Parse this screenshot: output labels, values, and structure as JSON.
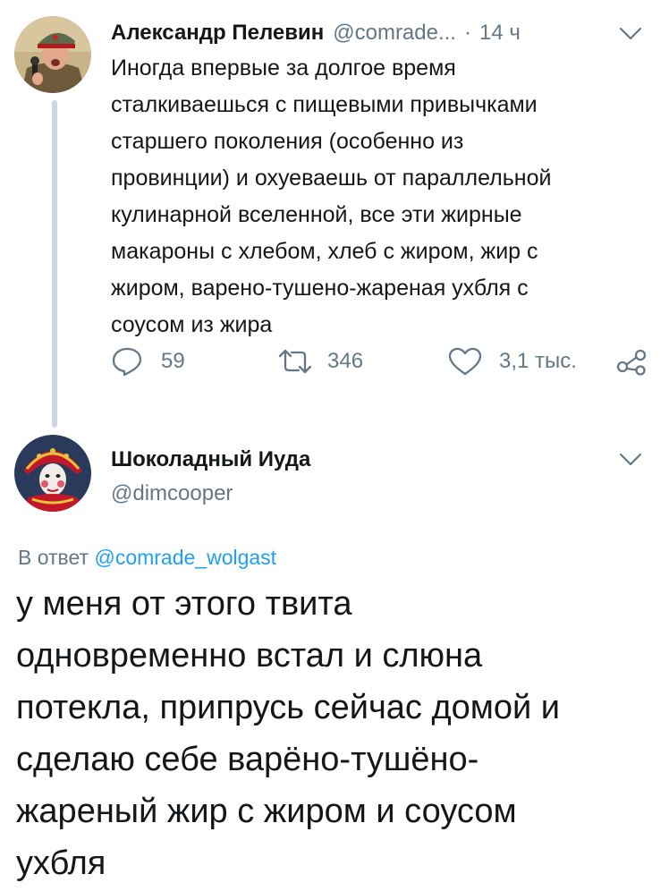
{
  "tweet1": {
    "author_name": "Александр Пелевин",
    "handle": "@comrade...",
    "separator": "·",
    "time": "14 ч",
    "text_lines": [
      "Иногда впервые за долгое время",
      "сталкиваешься с пищевыми привычками",
      "старшего поколения (особенно из",
      "провинции) и охуеваешь от параллельной",
      "кулинарной вселенной, все эти жирные",
      "макароны с хлебом, хлеб с жиром, жир с",
      "жиром, варено-тушено-жареная ухбля с",
      "соусом из жира"
    ],
    "replies": "59",
    "retweets": "346",
    "likes": "3,1 тыс.",
    "icons": {
      "reply": "reply-icon",
      "retweet": "retweet-icon",
      "like": "heart-icon",
      "share": "share-icon",
      "menu": "chevron-down-icon"
    }
  },
  "tweet2": {
    "author_name": "Шоколадный Иуда",
    "handle": "@dimcooper",
    "reply_prefix": "В ответ",
    "reply_mention": "@comrade_wolgast",
    "text_lines": [
      "у меня от этого твита",
      "одновременно встал и слюна",
      "потекла, припрусь сейчас домой и",
      "сделаю себе варёно-тушёно-",
      "жареный жир с жиром и соусом",
      "ухбля"
    ]
  },
  "colors": {
    "text": "#14171a",
    "secondary": "#657786",
    "link": "#1da1f2",
    "thread_line": "#ccd6dd"
  }
}
